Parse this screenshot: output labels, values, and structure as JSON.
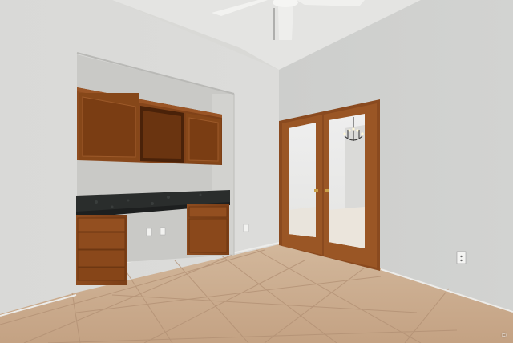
{
  "watermark": {
    "text": "©"
  },
  "colors": {
    "wall_left": "#d8d8d6",
    "wall_right": "#cfd0ce",
    "ceiling": "#e6e6e4",
    "niche_back": "#c8c8c5",
    "wood": "#8a4a1f",
    "wood_dark": "#6e3712",
    "countertop": "#2a2d2c",
    "floor_tile": "#c9a98c",
    "grout": "#b6957a"
  }
}
